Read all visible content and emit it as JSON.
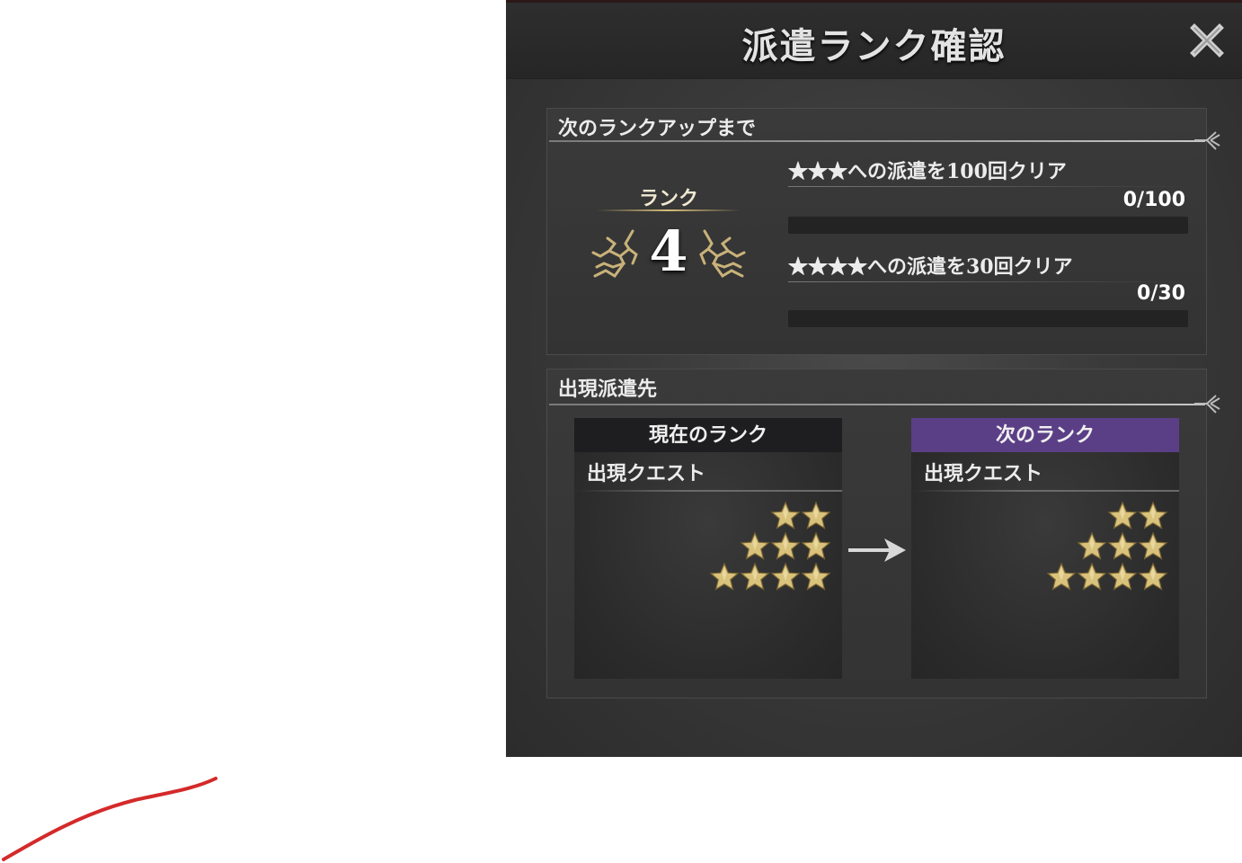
{
  "dialog": {
    "title": "派遣ランク確認"
  },
  "rank_section": {
    "header": "次のランクアップまで",
    "rank_label": "ランク",
    "rank_value": "4",
    "requirements": [
      {
        "label": "★★★への派遣を100回クリア",
        "count": "0/100",
        "progress": 0
      },
      {
        "label": "★★★★への派遣を30回クリア",
        "count": "0/30",
        "progress": 0
      }
    ]
  },
  "destination_section": {
    "header": "出現派遣先",
    "current": {
      "title": "現在のランク",
      "subtitle": "出現クエスト",
      "star_rows": [
        2,
        3,
        4
      ]
    },
    "next": {
      "title": "次のランク",
      "subtitle": "出現クエスト",
      "star_rows": [
        2,
        3,
        4
      ]
    }
  },
  "colors": {
    "next_rank_header": "#5b3f86",
    "star_gold": "#d9c27c"
  },
  "icons": [
    "close-icon",
    "line-ornament-icon",
    "rank-ornament-icon",
    "star-icon",
    "arrow-right-icon"
  ]
}
